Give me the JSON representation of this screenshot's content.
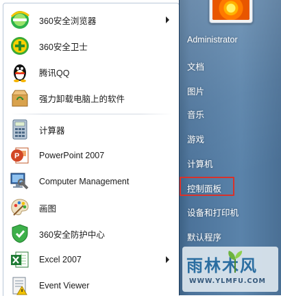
{
  "programs": [
    {
      "label": "360安全浏览器",
      "icon": "360-browser-icon",
      "has_arrow": true
    },
    {
      "label": "360安全卫士",
      "icon": "360-safeguard-icon",
      "has_arrow": false
    },
    {
      "label": "腾讯QQ",
      "icon": "qq-penguin-icon",
      "has_arrow": false
    },
    {
      "label": "强力卸载电脑上的软件",
      "icon": "uninstall-box-icon",
      "has_arrow": false
    },
    {
      "label": "计算器",
      "icon": "calculator-icon",
      "has_arrow": false
    },
    {
      "label": "PowerPoint 2007",
      "icon": "powerpoint-icon",
      "has_arrow": false
    },
    {
      "label": "Computer Management",
      "icon": "computer-management-icon",
      "has_arrow": false
    },
    {
      "label": "画图",
      "icon": "paint-palette-icon",
      "has_arrow": false
    },
    {
      "label": "360安全防护中心",
      "icon": "360-shield-icon",
      "has_arrow": false
    },
    {
      "label": "Excel 2007",
      "icon": "excel-icon",
      "has_arrow": true
    },
    {
      "label": "Event Viewer",
      "icon": "event-viewer-icon",
      "has_arrow": false
    }
  ],
  "right_menu": {
    "user": "Administrator",
    "items": [
      "文档",
      "图片",
      "音乐",
      "游戏",
      "计算机",
      "控制面板",
      "设备和打印机",
      "默认程序"
    ],
    "highlighted": "控制面板"
  },
  "watermark": {
    "brand": "雨林木风",
    "url": "WWW.YLMFU.COM"
  },
  "colors": {
    "right_pane": "#5a83aa",
    "highlight_border": "#d9312a",
    "watermark_text": "#2b6ea1"
  }
}
